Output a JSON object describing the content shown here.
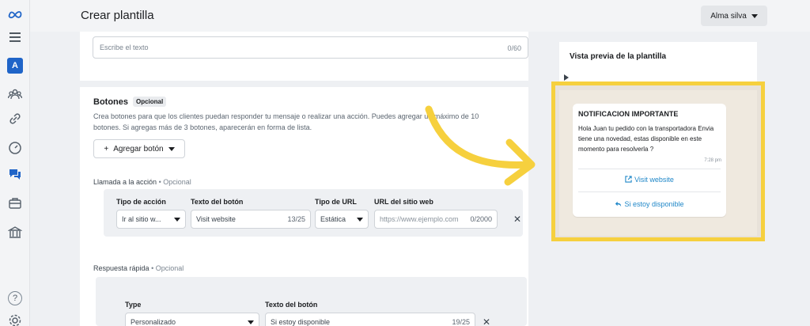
{
  "app": {
    "title": "Crear plantilla",
    "user": "Alma silva"
  },
  "rail": {
    "icons": [
      "meta-logo-icon",
      "menu-icon",
      "account-avatar",
      "people-icon",
      "link-icon",
      "speedometer-icon",
      "chat-icon",
      "briefcase-icon",
      "bank-icon",
      "help-icon",
      "settings-icon"
    ],
    "avatar_letter": "A",
    "help_label": "?"
  },
  "header_text": {
    "placeholder": "Escribe el texto",
    "counter": "0/60"
  },
  "buttons_section": {
    "title": "Botones",
    "badge": "Opcional",
    "description": "Crea botones para que los clientes puedan responder tu mensaje o realizar una acción. Puedes agregar un máximo de 10 botones. Si agregas más de 3 botones, aparecerán en forma de lista.",
    "add_button": "Agregar botón",
    "add_icon": "+"
  },
  "call_to_action": {
    "label": "Llamada a la acción",
    "optional": "• Opcional",
    "col_action_type": "Tipo de acción",
    "col_button_text": "Texto del botón",
    "col_url_type": "Tipo de URL",
    "col_url": "URL del sitio web",
    "action_type_value": "Ir al sitio w...",
    "button_text_value": "Visit website",
    "button_text_counter": "13/25",
    "url_type_value": "Estática",
    "url_placeholder": "https://www.ejemplo.com",
    "url_counter": "0/2000",
    "remove": "✕"
  },
  "quick_reply": {
    "label": "Respuesta rápida",
    "optional": "• Opcional",
    "col_type": "Type",
    "col_button_text": "Texto del botón",
    "type_value": "Personalizado",
    "button_text_value": "Si estoy disponible",
    "button_text_counter": "19/25",
    "remove": "✕"
  },
  "preview": {
    "title": "Vista previa de la plantilla",
    "message_title": "NOTIFICACION IMPORTANTE",
    "message_body": "Hola Juan tu pedido con la transportadora Envia tiene una novedad, estas disponible en este momento para resolverla ?",
    "time": "7:28 pm",
    "cta_button": "Visit website",
    "reply_button": "Si estoy disponible"
  },
  "colors": {
    "highlight": "#f6d03e",
    "link": "#1f87c8",
    "avatar": "#1f64c8"
  }
}
